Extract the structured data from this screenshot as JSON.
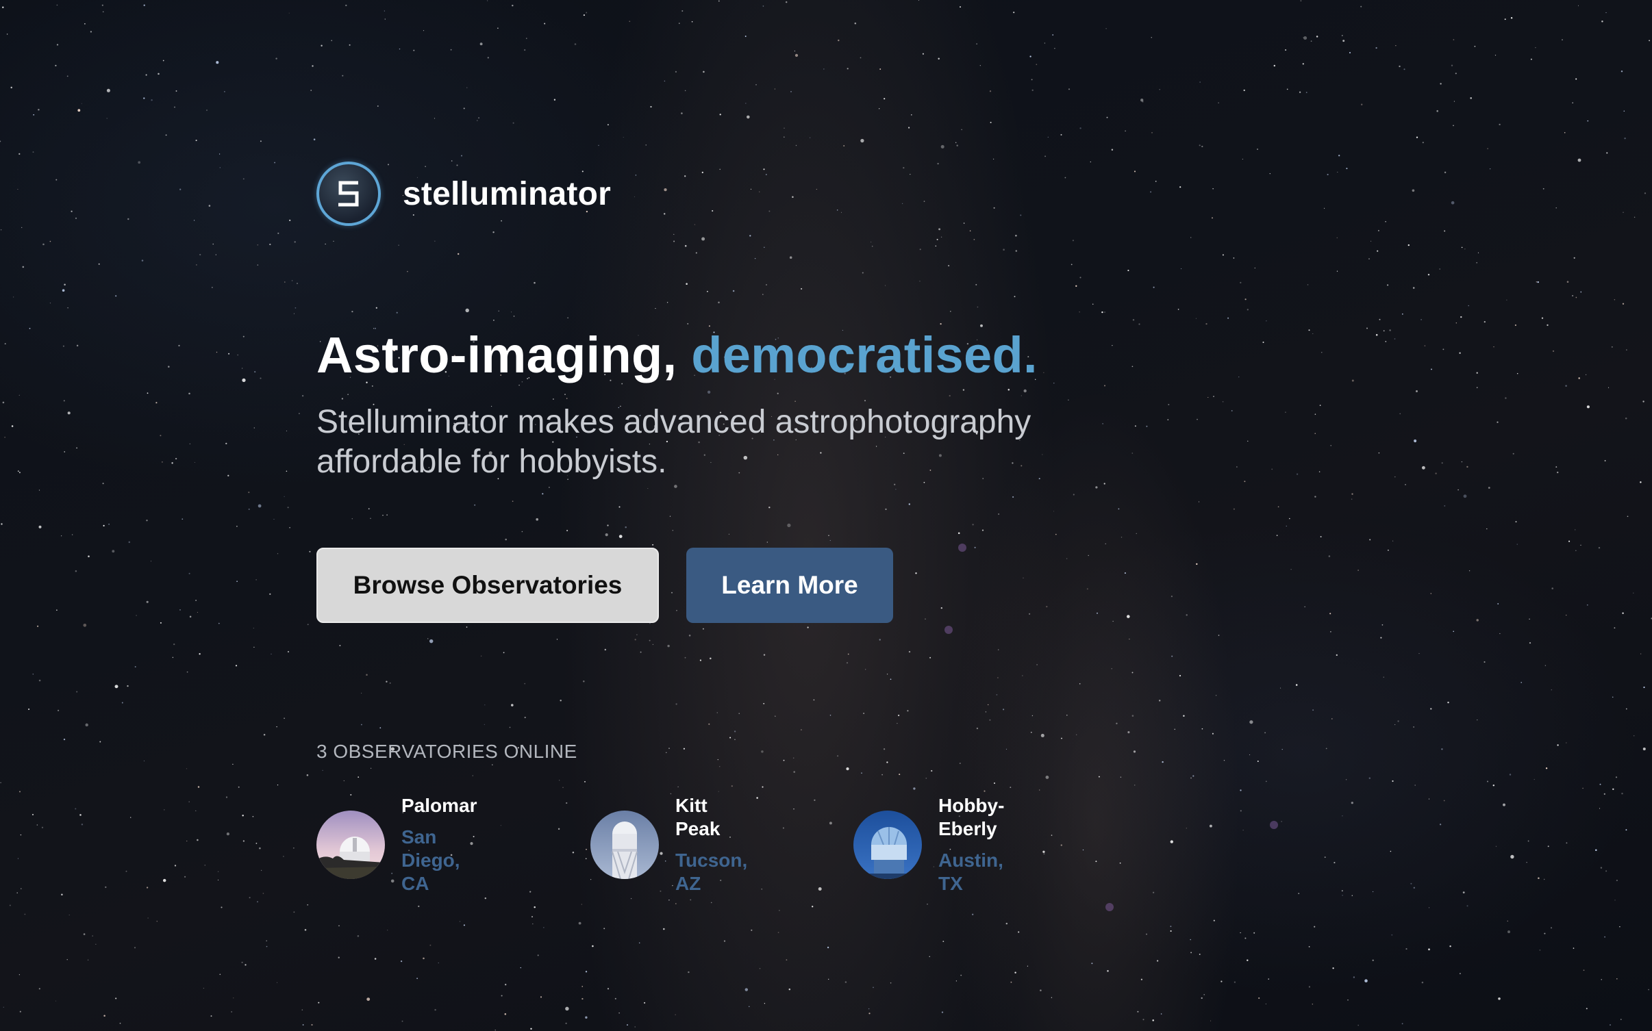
{
  "brand": {
    "logo_icon": "s-logo-icon",
    "name": "stelluminator",
    "accent_color": "#5ea6d6"
  },
  "hero": {
    "headline_main": "Astro-imaging, ",
    "headline_accent": "democratised.",
    "accent_color": "#5aa3d0",
    "subtitle": "Stelluminator makes advanced astrophotography affordable for hobbyists."
  },
  "actions": {
    "primary_label": "Browse Observatories",
    "secondary_label": "Learn More",
    "primary_color": "#d8d8d8",
    "secondary_color": "#3a5a82"
  },
  "observatories": {
    "online_label": "3 OBSERVATORIES ONLINE",
    "items": [
      {
        "name": "Palomar",
        "location": "San Diego, CA",
        "icon": "observatory-dome-icon"
      },
      {
        "name": "Kitt Peak",
        "location": "Tucson, AZ",
        "icon": "observatory-tower-icon"
      },
      {
        "name": "Hobby-Eberly",
        "location": "Austin, TX",
        "icon": "observatory-dome-icon"
      }
    ],
    "location_color": "#3f6590"
  }
}
